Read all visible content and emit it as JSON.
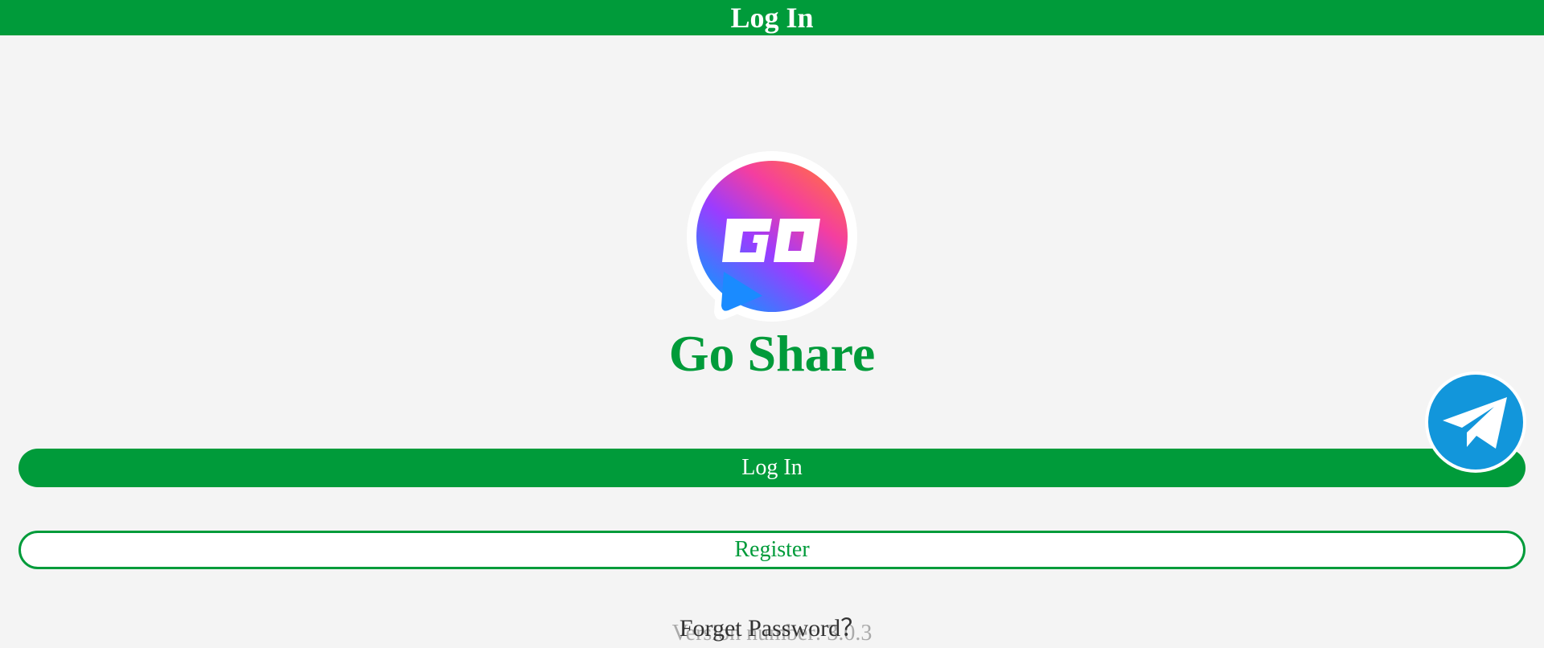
{
  "header": {
    "title": "Log In"
  },
  "logo": {
    "icon": "go-share-logo",
    "text": "GO"
  },
  "app": {
    "name": "Go Share"
  },
  "actions": {
    "login_label": "Log In",
    "register_label": "Register",
    "forget_password_label": "Forget Password？"
  },
  "footer": {
    "version_label": "Version number: 3.0.3"
  },
  "telegram": {
    "icon": "telegram-icon"
  },
  "colors": {
    "primary": "#009b3a",
    "background": "#f4f4f4",
    "telegram": "#1296db"
  }
}
